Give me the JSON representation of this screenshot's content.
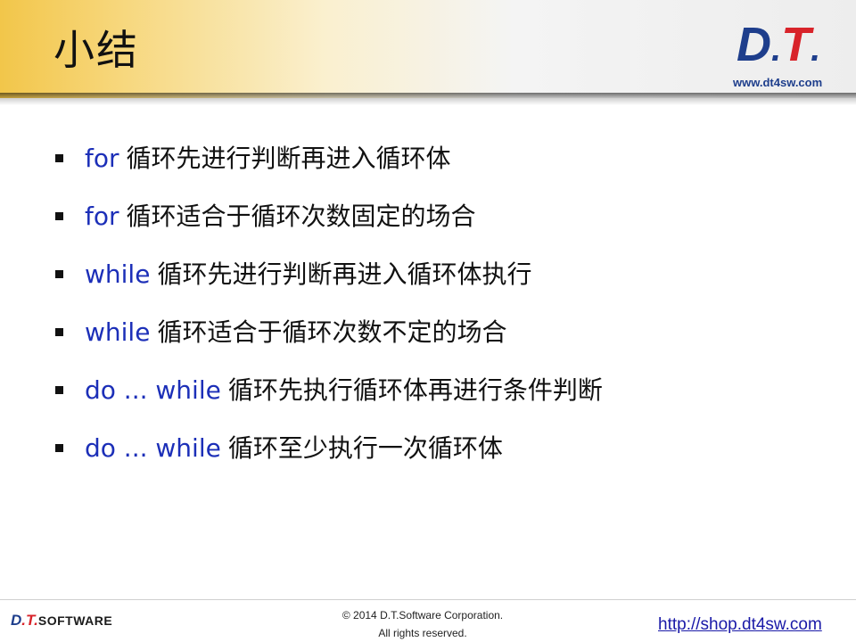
{
  "header": {
    "title": "小结",
    "logo": {
      "d": "D",
      "dot": ".",
      "t": "T",
      "dot2": "."
    },
    "logo_url": "www.dt4sw.com"
  },
  "bullets": [
    {
      "keyword": "for",
      "text": "循环先进行判断再进入循环体"
    },
    {
      "keyword": "for",
      "text": "循环适合于循环次数固定的场合"
    },
    {
      "keyword": "while",
      "text": "循环先进行判断再进入循环体执行"
    },
    {
      "keyword": "while",
      "text": "循环适合于循环次数不定的场合"
    },
    {
      "keyword": "do ... while",
      "text": "循环先执行循环体再进行条件判断"
    },
    {
      "keyword": "do ... while",
      "text": "循环至少执行一次循环体"
    }
  ],
  "footer": {
    "logo": {
      "d": "D",
      "t": ".T.",
      "software": "SOFTWARE"
    },
    "copyright_line1": "© 2014 D.T.Software Corporation.",
    "copyright_line2": "All rights reserved.",
    "link": "http://shop.dt4sw.com"
  },
  "colors": {
    "keyword": "#1c2fb8",
    "logo_blue": "#1e3e8c",
    "logo_red": "#d8232a",
    "header_gold": "#f2c64a",
    "link": "#1a1aa8"
  }
}
